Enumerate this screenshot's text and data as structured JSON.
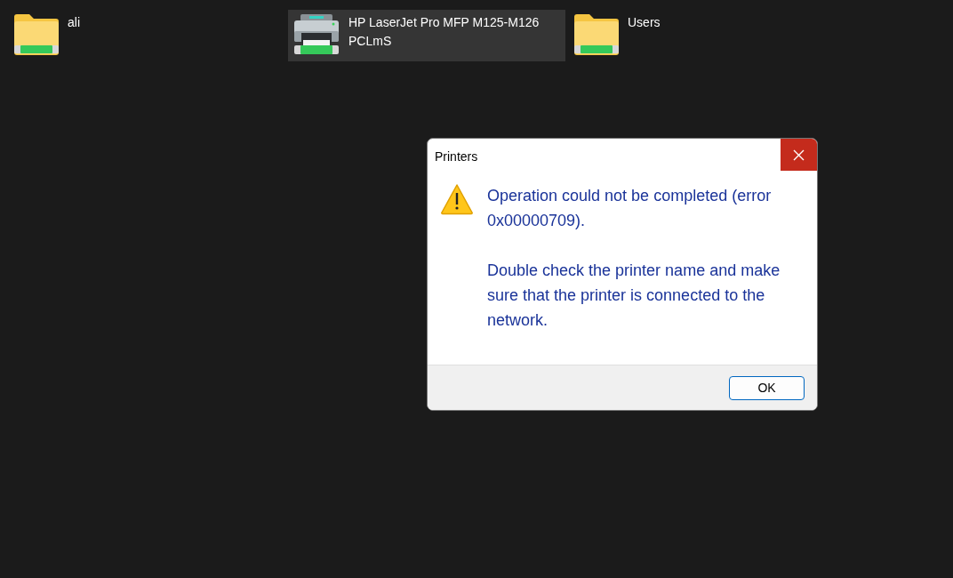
{
  "desktop_items": [
    {
      "kind": "folder",
      "label": "ali",
      "selected": false
    },
    {
      "kind": "printer",
      "label": "HP LaserJet Pro MFP M125-M126 PCLmS",
      "selected": true
    },
    {
      "kind": "folder",
      "label": "Users",
      "selected": false
    }
  ],
  "dialog": {
    "title": "Printers",
    "message": [
      "Operation could not be completed (error 0x00000709).",
      "Double check the printer name and make sure that the printer is connected to the network."
    ],
    "buttons": [
      "OK"
    ]
  }
}
